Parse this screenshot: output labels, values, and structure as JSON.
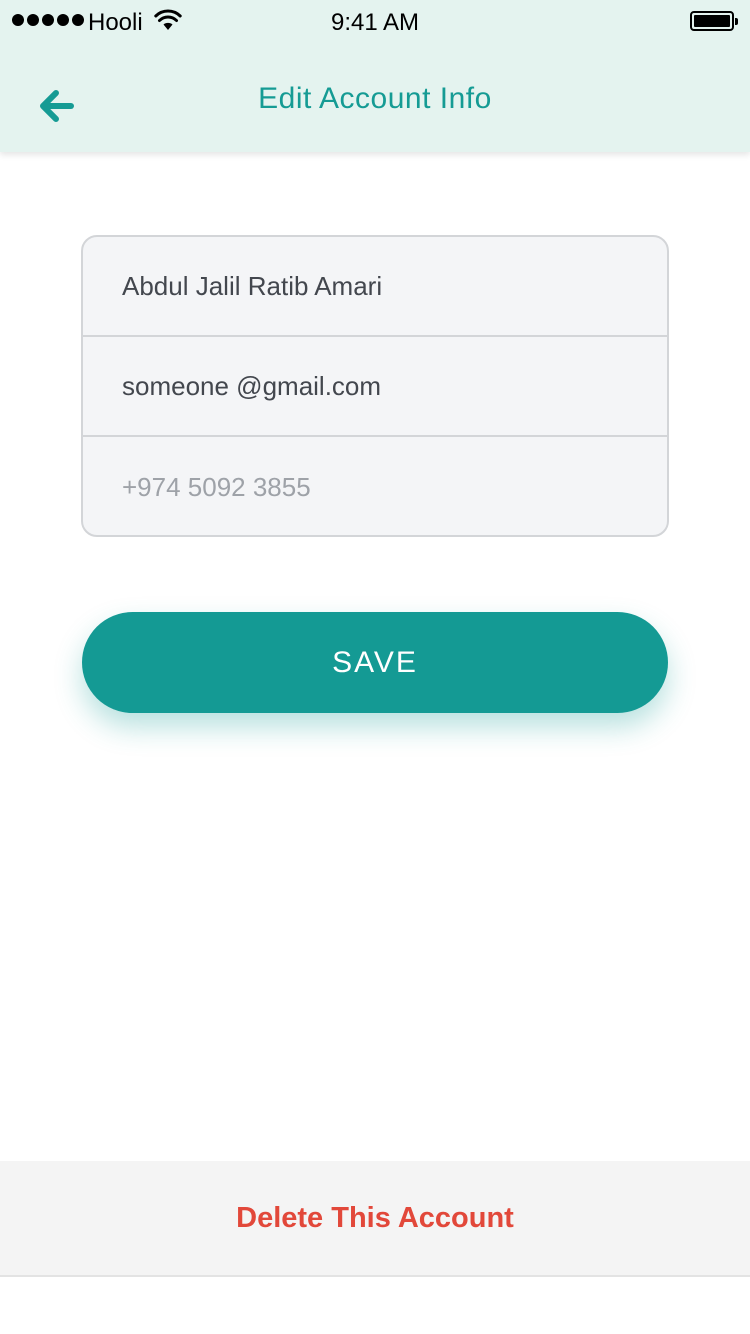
{
  "status_bar": {
    "carrier": "Hooli",
    "time": "9:41 AM",
    "signal_icon": "signal-dots-icon",
    "wifi_icon": "wifi-icon",
    "battery_icon": "battery-icon",
    "battery_level": 1.0
  },
  "header": {
    "title": "Edit Account Info",
    "back_icon": "arrow-left-icon",
    "accent_color": "#159b94"
  },
  "form": {
    "name": {
      "value": "Abdul Jalil Ratib Amari",
      "placeholder": ""
    },
    "email": {
      "value": "someone @gmail.com",
      "placeholder": ""
    },
    "phone": {
      "value": "",
      "placeholder": "+974 5092 3855"
    }
  },
  "save_button": {
    "label": "SAVE",
    "color": "#149a94"
  },
  "footer": {
    "delete_label": "Delete This Account",
    "delete_color": "#e2483a"
  }
}
